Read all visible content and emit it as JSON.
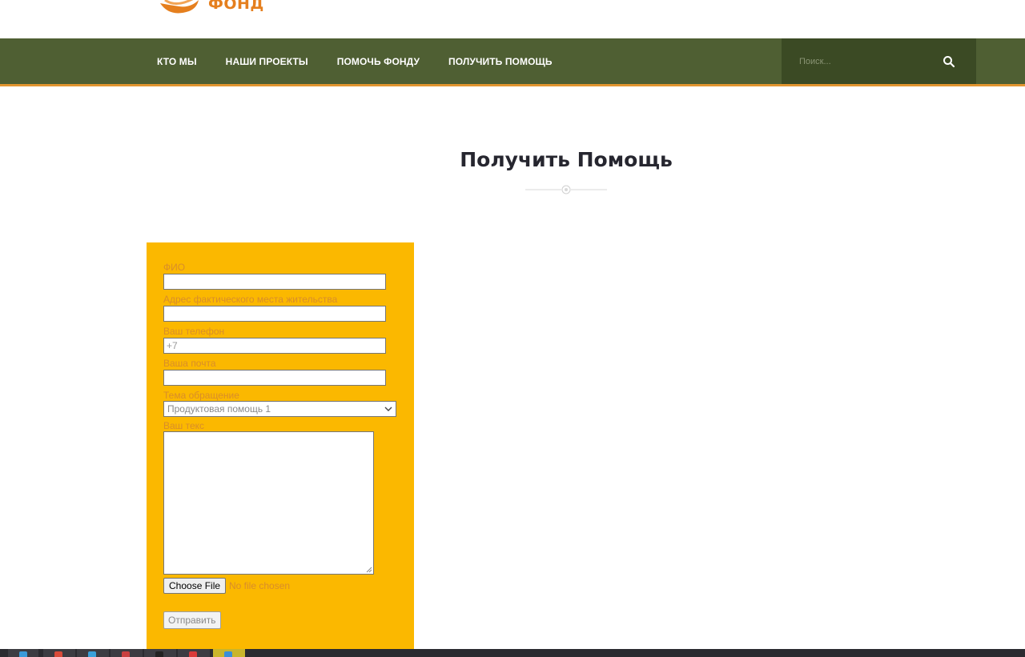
{
  "logo": {
    "text": "ФОНД",
    "icon": "hands-logo-icon",
    "color": "#e57f1e"
  },
  "nav": {
    "items": [
      {
        "label": "КТО МЫ"
      },
      {
        "label": "НАШИ ПРОЕКТЫ"
      },
      {
        "label": "ПОМОЧЬ ФОНДУ"
      },
      {
        "label": "ПОЛУЧИТЬ ПОМОЩЬ"
      }
    ],
    "search_placeholder": "Поиск...",
    "search_icon": "search-icon",
    "background": "#4f5f33",
    "accent": "#e29530"
  },
  "page": {
    "title": "Получить Помощь"
  },
  "form": {
    "background": "#fbb800",
    "fields": {
      "fio": {
        "label": "ФИО",
        "value": ""
      },
      "address": {
        "label": "Адрес фактического места жительства",
        "value": ""
      },
      "phone": {
        "label": "Ваш телефон",
        "value": "+7"
      },
      "email": {
        "label": "Ваша почта",
        "value": ""
      },
      "topic": {
        "label": "Тема обращение",
        "selected": "Продуктовая помощь 1"
      },
      "message": {
        "label": "Ваш текс",
        "value": ""
      }
    },
    "file_button": "Choose File",
    "file_status": "No file chosen",
    "submit": "Отправить"
  },
  "taskbar": {
    "icons": [
      "windows-start-icon",
      "chrome-icon",
      "telegram-icon",
      "app-icon",
      "terminal-icon",
      "opera-icon",
      "active-app-icon"
    ]
  }
}
